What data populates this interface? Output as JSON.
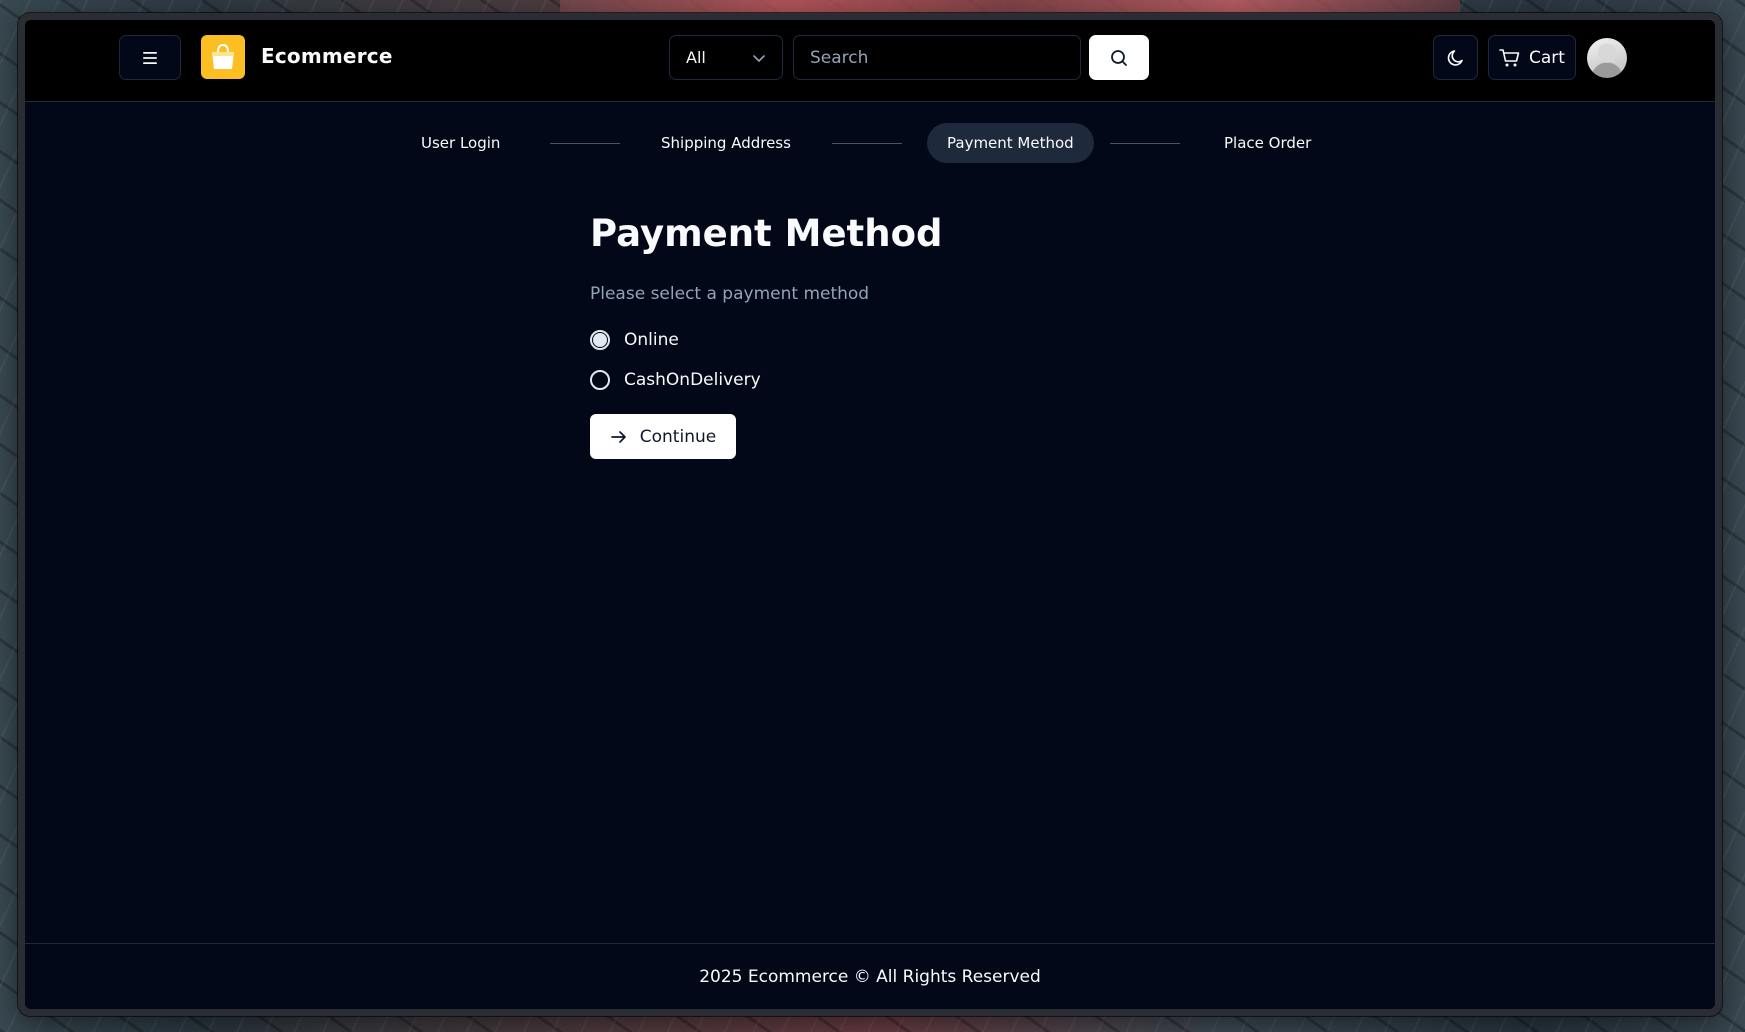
{
  "header": {
    "brand": "Ecommerce",
    "category_selected": "All",
    "search_placeholder": "Search",
    "cart_label": "Cart"
  },
  "stepper": {
    "steps": [
      {
        "label": "User Login",
        "active": false
      },
      {
        "label": "Shipping Address",
        "active": false
      },
      {
        "label": "Payment Method",
        "active": true
      },
      {
        "label": "Place Order",
        "active": false
      }
    ]
  },
  "main": {
    "title": "Payment Method",
    "subtitle": "Please select a payment method",
    "options": [
      {
        "label": "Online",
        "checked": true
      },
      {
        "label": "CashOnDelivery",
        "checked": false
      }
    ],
    "continue_label": "Continue"
  },
  "footer": {
    "text": "2025 Ecommerce © All Rights Reserved"
  },
  "colors": {
    "background": "#020817",
    "header": "#000000",
    "border": "#1e293b",
    "logo": "#fbbf24",
    "muted_text": "#94a3b8",
    "primary_button": "#ffffff"
  },
  "icons": {
    "menu": "hamburger-icon",
    "logo": "shopping-bag-icon",
    "dropdown": "chevron-down-icon",
    "search": "search-icon",
    "theme": "moon-icon",
    "cart": "cart-icon",
    "continue": "arrow-right-icon"
  }
}
